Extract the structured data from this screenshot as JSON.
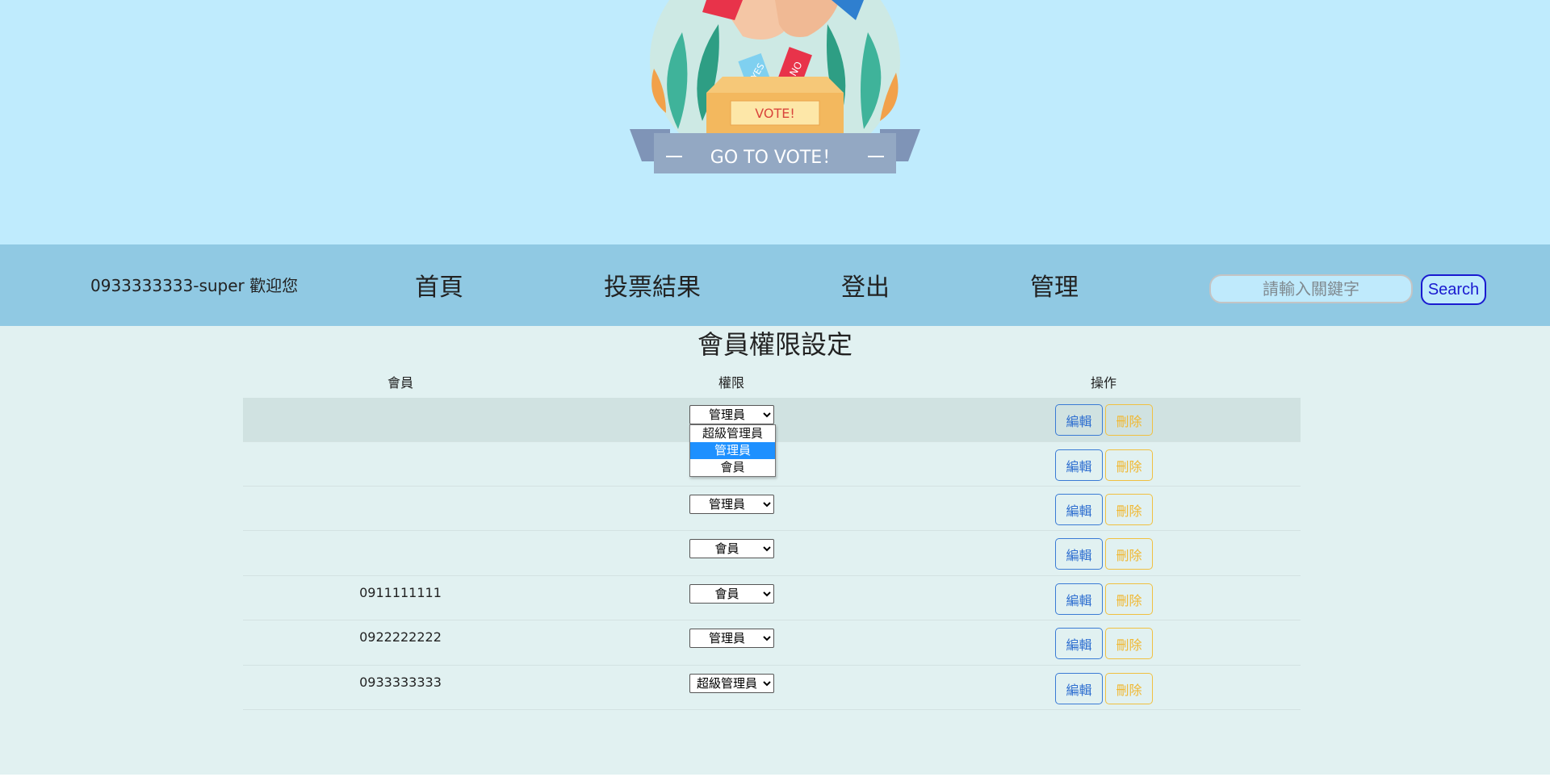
{
  "banner": {
    "logo_text": "GO TO VOTE！",
    "box_label": "VOTE!",
    "ballot_yes": "YES",
    "ballot_no": "NO"
  },
  "nav": {
    "welcome": "0933333333-super 歡迎您",
    "links": [
      "首頁",
      "投票結果",
      "登出",
      "管理"
    ],
    "search_placeholder": "請輸入關鍵字",
    "search_label": "Search"
  },
  "page": {
    "title": "會員權限設定",
    "headers": {
      "member": "會員",
      "role": "權限",
      "action": "操作"
    }
  },
  "role_options": [
    "超級管理員",
    "管理員",
    "會員"
  ],
  "rows": [
    {
      "member": "",
      "role": "管理員"
    },
    {
      "member": "",
      "role": ""
    },
    {
      "member": "",
      "role": "管理員"
    },
    {
      "member": "",
      "role": "會員"
    },
    {
      "member": "0911111111",
      "role": "會員"
    },
    {
      "member": "0922222222",
      "role": "管理員"
    },
    {
      "member": "0933333333",
      "role": "超級管理員"
    }
  ],
  "buttons": {
    "edit": "編輯",
    "delete": "刪除"
  },
  "open_dropdown": {
    "options": [
      "超級管理員",
      "管理員",
      "會員"
    ],
    "highlighted": "管理員"
  },
  "colors": {
    "banner_bg": "#bfebfd",
    "nav_bg": "#90c9e3",
    "content_bg": "#e1f1f1",
    "edit": "#2f6fd0",
    "delete": "#f0b832",
    "highlight": "#1e90ff"
  }
}
